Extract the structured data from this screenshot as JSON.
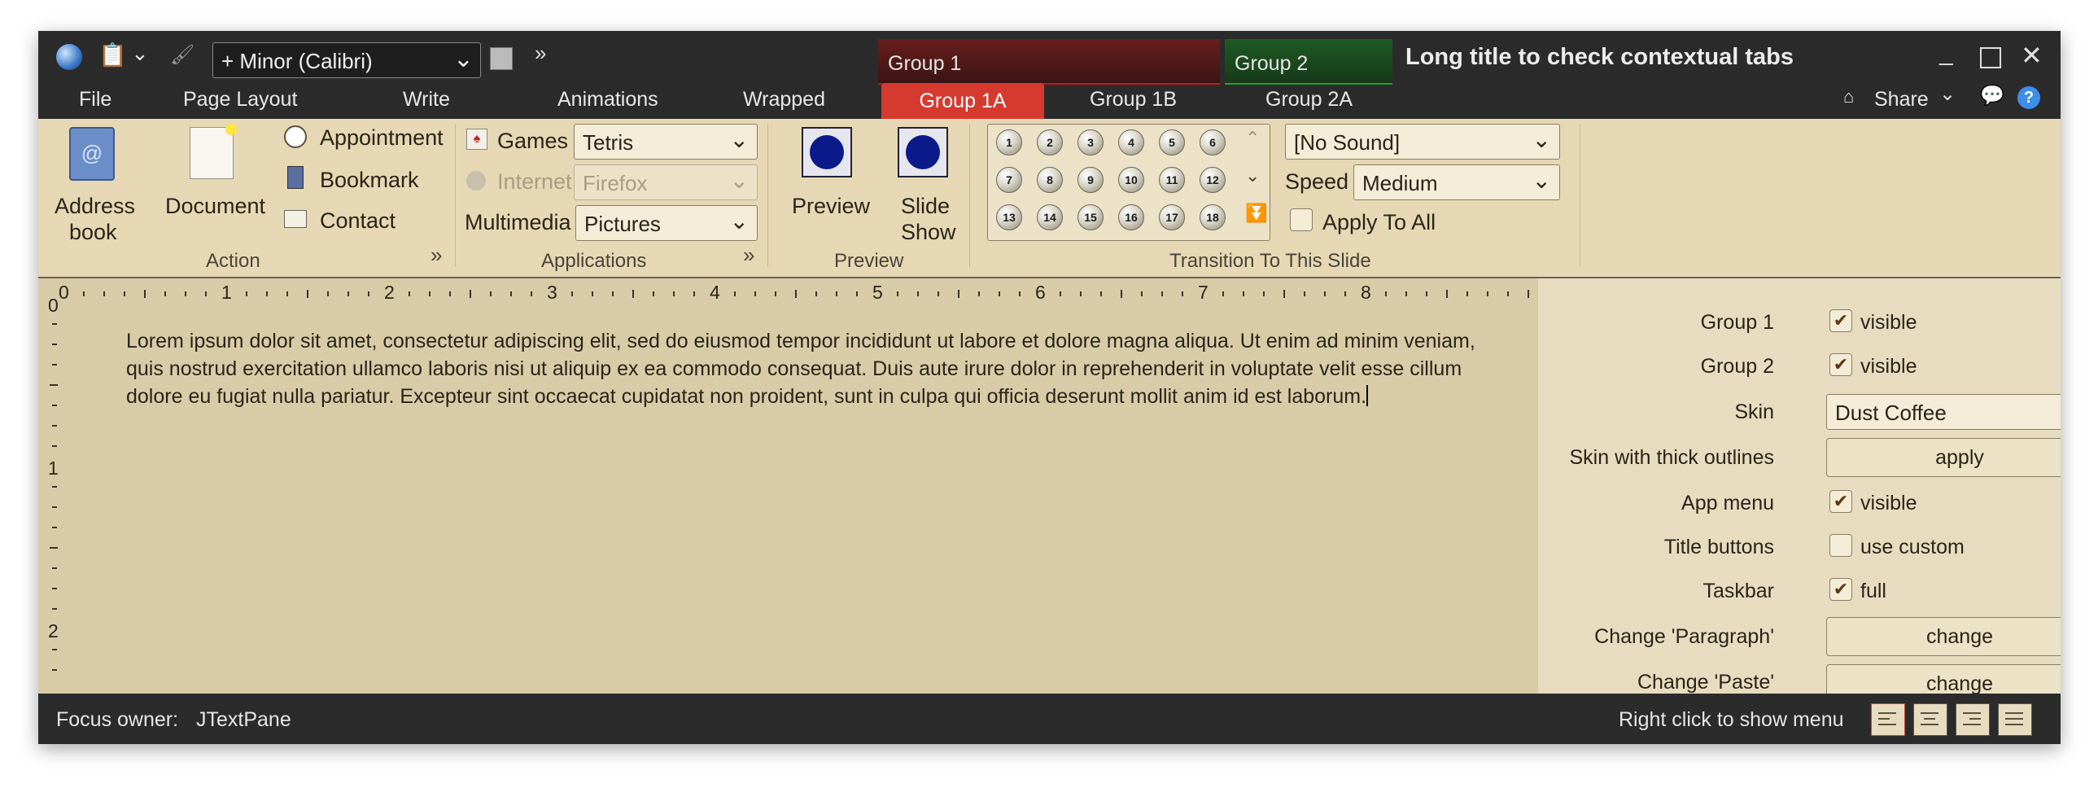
{
  "titlebar": {
    "font_combo": "+ Minor (Calibri)",
    "title": "Long title to check contextual tabs",
    "context_groups": [
      "Group 1",
      "Group 2"
    ],
    "share_label": "Share",
    "help_label": "?"
  },
  "tabs": [
    {
      "label": "File"
    },
    {
      "label": "Page Layout"
    },
    {
      "label": "Write"
    },
    {
      "label": "Animations"
    },
    {
      "label": "Wrapped"
    },
    {
      "label": "Group 1A",
      "selected": true
    },
    {
      "label": "Group 1B"
    },
    {
      "label": "Group 2A"
    }
  ],
  "ribbon": {
    "action": {
      "label": "Action",
      "address_book": [
        "Address",
        "book"
      ],
      "document": "Document",
      "items": [
        "Appointment",
        "Bookmark",
        "Contact"
      ]
    },
    "applications": {
      "label": "Applications",
      "games_label": "Games",
      "games_value": "Tetris",
      "internet_label": "Internet",
      "internet_value": "Firefox",
      "multimedia_label": "Multimedia",
      "multimedia_value": "Pictures"
    },
    "preview": {
      "label": "Preview",
      "preview_btn": "Preview",
      "slideshow_btn": [
        "Slide",
        "Show"
      ]
    },
    "transition": {
      "label": "Transition To This Slide",
      "gallery": [
        "1",
        "2",
        "3",
        "4",
        "5",
        "6",
        "7",
        "8",
        "9",
        "10",
        "11",
        "12",
        "13",
        "14",
        "15",
        "16",
        "17",
        "18"
      ],
      "sound_value": "[No Sound]",
      "speed_label": "Speed",
      "speed_value": "Medium",
      "apply_all": "Apply To All"
    }
  },
  "ruler": {
    "h_numbers": [
      "0",
      "1",
      "2",
      "3",
      "4",
      "5",
      "6",
      "7",
      "8"
    ],
    "v_numbers": [
      "0",
      "1",
      "2"
    ]
  },
  "editor": {
    "text": "Lorem ipsum dolor sit amet, consectetur adipiscing elit, sed do eiusmod tempor incididunt ut labore et dolore magna aliqua. Ut enim ad minim veniam, quis nostrud exercitation ullamco laboris nisi ut aliquip ex ea commodo consequat. Duis aute irure dolor in reprehenderit in voluptate velit esse cillum dolore eu fugiat nulla pariatur. Excepteur sint occaecat cupidatat non proident, sunt in culpa qui officia deserunt mollit anim id est laborum."
  },
  "panel": {
    "group1_label": "Group 1",
    "group1_value": "visible",
    "group1_checked": true,
    "group2_label": "Group 2",
    "group2_value": "visible",
    "group2_checked": true,
    "skin_label": "Skin",
    "skin_value": "Dust Coffee",
    "thick_label": "Skin with thick outlines",
    "thick_btn": "apply",
    "appmenu_label": "App menu",
    "appmenu_value": "visible",
    "appmenu_checked": true,
    "titlebtn_label": "Title buttons",
    "titlebtn_value": "use custom",
    "titlebtn_checked": false,
    "taskbar_label": "Taskbar",
    "taskbar_value": "full",
    "taskbar_checked": true,
    "paragraph_label": "Change 'Paragraph'",
    "paragraph_btn": "change",
    "paste_label": "Change 'Paste'",
    "paste_btn": "change"
  },
  "status": {
    "focus_label": "Focus owner:",
    "focus_value": "JTextPane",
    "right_hint": "Right click to show menu"
  }
}
